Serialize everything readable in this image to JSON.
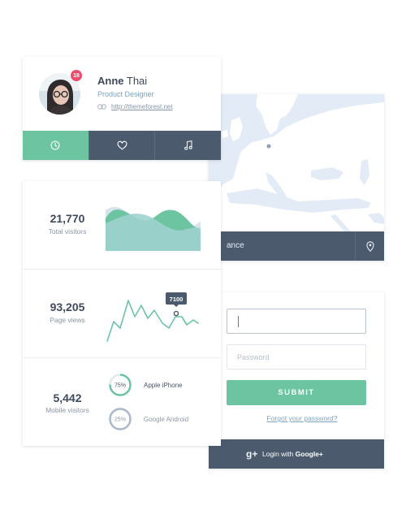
{
  "profile": {
    "first_name": "Anne",
    "last_name": "Thai",
    "role": "Product Designer",
    "website": "http://themeforest.net",
    "notification_count": "18",
    "tabs": [
      {
        "icon": "clock-icon",
        "active": true
      },
      {
        "icon": "heart-icon",
        "active": false
      },
      {
        "icon": "music-icon",
        "active": false
      }
    ]
  },
  "stats": {
    "total_visitors": {
      "value": "21,770",
      "label": "Total visitors"
    },
    "page_views": {
      "value": "93,205",
      "label": "Page views",
      "tooltip": "7100"
    },
    "mobile_visitors": {
      "value": "5,442",
      "label": "Mobile visitors",
      "devices": [
        {
          "name": "Apple iPhone",
          "percent": 75,
          "percent_label": "75%",
          "color": "#6cc4a1"
        },
        {
          "name": "Google Android",
          "percent": 25,
          "percent_label": "25%",
          "color": "#a9b8cc"
        }
      ]
    }
  },
  "map": {
    "location_label": "ance",
    "pin_icon": "location-pin-icon"
  },
  "login": {
    "password_placeholder": "Password",
    "submit_label": "SUBMIT",
    "forgot_label": "Forgot your password?",
    "google_prefix": "Login with ",
    "google_brand": "Google+",
    "google_icon": "google-plus-icon"
  },
  "colors": {
    "accent": "#6cc4a1",
    "dark": "#4c5a6d",
    "badge": "#ef4c6b",
    "map_sea": "#e3ebf6",
    "map_land": "#ffffff"
  }
}
